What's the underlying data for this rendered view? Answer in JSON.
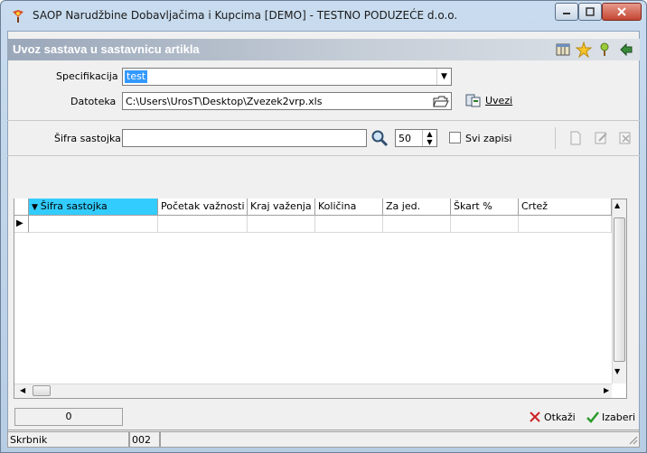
{
  "window": {
    "title": "SAOP  Narudžbine Dobavljačima i Kupcima [DEMO] - TESTNO PODUZEĆE d.o.o.",
    "min_icon": "minimize-icon",
    "max_icon": "maximize-icon",
    "close_icon": "close-icon"
  },
  "header": {
    "title": "Uvoz sastava u sastavnicu artikla"
  },
  "form": {
    "spec_label": "Specifikacija",
    "spec_value": "test",
    "file_label": "Datoteka",
    "file_value": "C:\\Users\\UrosT\\Desktop\\Zvezek2vrp.xls",
    "import_button": "Uvezi"
  },
  "search": {
    "label": "Šifra sastojka",
    "value": "",
    "count": "50",
    "all_records_label": "Svi zapisi"
  },
  "grid": {
    "columns": [
      "Šifra sastojka",
      "Početak važnosti",
      "Kraj važenja",
      "Količina",
      "Za jed.",
      "Škart %",
      "Crtež"
    ]
  },
  "footer": {
    "count_value": "0",
    "cancel_label": "Otkaži",
    "choose_label": "Izaberi"
  },
  "status": {
    "user_label": "Skrbnik",
    "user_value": "002"
  },
  "colors": {
    "selection": "#3399ff",
    "sorted_column": "#33ccff",
    "cancel_red": "#cc2222",
    "confirm_green": "#2a9a2a"
  }
}
